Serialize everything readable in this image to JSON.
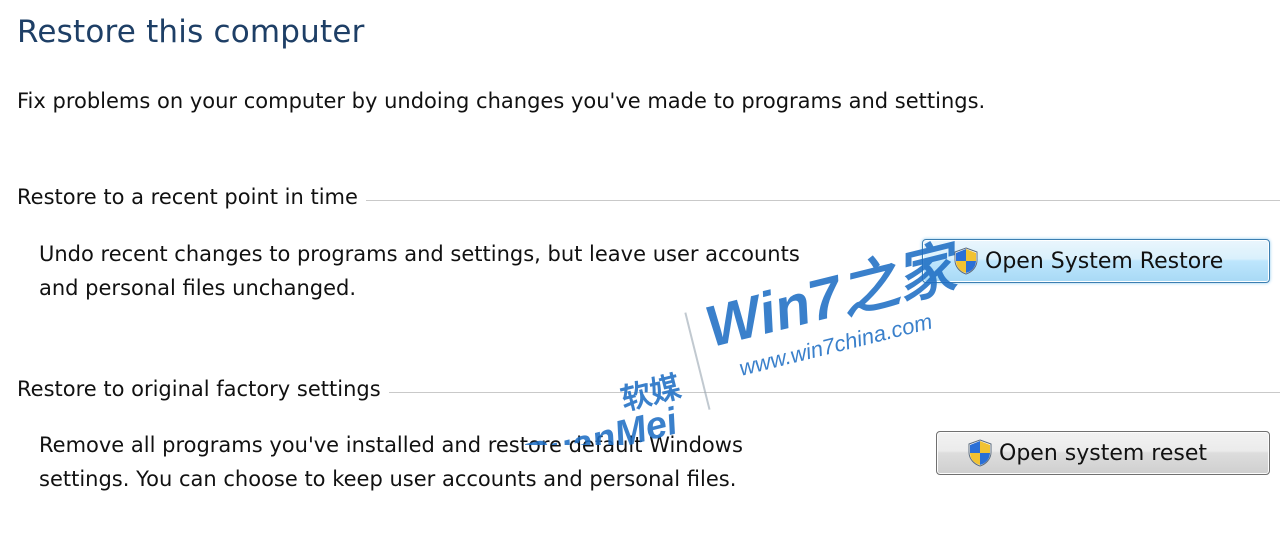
{
  "page": {
    "title": "Restore this computer",
    "intro": "Fix problems on your computer by undoing changes you've made to programs and settings."
  },
  "sections": [
    {
      "header": "Restore to a recent point in time",
      "description_lines": [
        "Undo recent changes to programs and settings, but leave user accounts",
        "and personal files unchanged."
      ],
      "button_label": "Open System Restore",
      "button_icon": "uac-shield-icon"
    },
    {
      "header": "Restore to original factory settings",
      "description_lines": [
        "Remove all programs you've installed and restore default Windows",
        "settings. You can choose to keep user accounts and personal files."
      ],
      "button_label": "Open system reset",
      "button_icon": "uac-shield-icon"
    }
  ],
  "watermark": {
    "brand_left": "RuanMei",
    "brand_left_cn": "软媒",
    "brand_right": "Win7之家",
    "url": "www.win7china.com"
  },
  "colors": {
    "title": "#1e3f66",
    "primary_button_border": "#3c7fb1",
    "watermark": "#1f6fc4"
  }
}
